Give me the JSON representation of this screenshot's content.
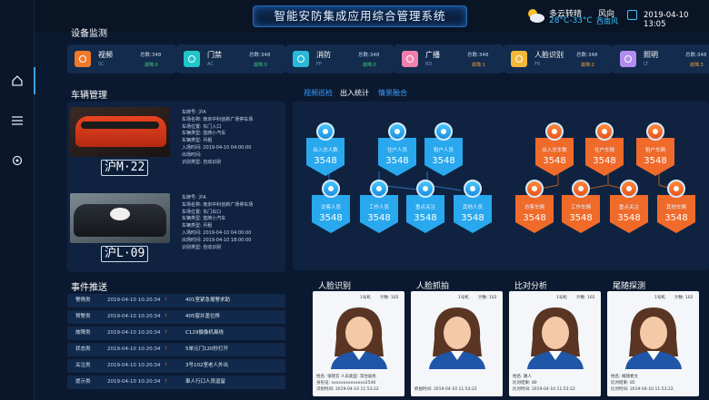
{
  "header": {
    "title": "智能安防集成应用综合管理系统",
    "weather": {
      "desc": "多云转晴",
      "temp": "28°C-33°C"
    },
    "wind": {
      "label": "风向",
      "value": "西南风"
    },
    "date": "2019-04-10 13:05"
  },
  "sections": {
    "device": "设备监测",
    "vehicle": "车辆管理",
    "events": "事件推送"
  },
  "devices": [
    {
      "name": "视频",
      "abbr": "SC",
      "total": "总数:348",
      "fault": "故障:0",
      "icon": "eye-icon",
      "color": "#f07a2b"
    },
    {
      "name": "门禁",
      "abbr": "AC",
      "total": "总数:348",
      "fault": "故障:0",
      "icon": "door-icon",
      "color": "#1fc7c9"
    },
    {
      "name": "消防",
      "abbr": "FP",
      "total": "总数:348",
      "fault": "故障:0",
      "icon": "fire-icon",
      "color": "#2bb7d9"
    },
    {
      "name": "广播",
      "abbr": "BD",
      "total": "总数:348",
      "fault": "故障:1",
      "icon": "speaker-icon",
      "color": "#f07fae"
    },
    {
      "name": "人脸识别",
      "abbr": "FR",
      "total": "总数:348",
      "fault": "故障:2",
      "icon": "face-icon",
      "color": "#f3b83a"
    },
    {
      "name": "照明",
      "abbr": "LT",
      "total": "总数:348",
      "fault": "故障:3",
      "icon": "bulb-icon",
      "color": "#b38cf0"
    }
  ],
  "vehicles": [
    {
      "plate": "沪M·22",
      "lines": [
        "车牌号: 沪A",
        "车场名称: 南京中科创新广场停车场",
        "车场位置: 东门入口",
        "车辆类型: 蓝牌小汽车",
        "车辆类型: 月租",
        "入场时间: 2019-04-10 04:00:00",
        "出场时间:",
        "识别类型: 自动识别"
      ]
    },
    {
      "plate": "沪L·09",
      "lines": [
        "车牌号: 沪A",
        "车场名称: 南京中科创新广场停车场",
        "车场位置: 东门出口",
        "车辆类型: 蓝牌小汽车",
        "车辆类型: 月租",
        "入场时间: 2019-04-10 04:00:00",
        "出场时间: 2019-04-10 18:00:00",
        "识别类型: 自动识别"
      ]
    }
  ],
  "tabs": [
    "视频巡检",
    "出入统计",
    "情景融合"
  ],
  "stats_blue_top": [
    {
      "label": "出入总人数",
      "value": "3548"
    },
    {
      "label": "住户人员",
      "value": "3548"
    },
    {
      "label": "租户人员",
      "value": "3548"
    }
  ],
  "stats_blue_bottom": [
    {
      "label": "访客人员",
      "value": "3548"
    },
    {
      "label": "工作人员",
      "value": "3548"
    },
    {
      "label": "重点关注",
      "value": "3548"
    },
    {
      "label": "其他人员",
      "value": "3548"
    }
  ],
  "stats_orange_top": [
    {
      "label": "出入总车数",
      "value": "3548"
    },
    {
      "label": "住户车辆",
      "value": "3548"
    },
    {
      "label": "租户车辆",
      "value": "3548"
    }
  ],
  "stats_orange_bottom": [
    {
      "label": "访客车辆",
      "value": "3548"
    },
    {
      "label": "工作车辆",
      "value": "3548"
    },
    {
      "label": "重点关注",
      "value": "3548"
    },
    {
      "label": "其他车辆",
      "value": "3548"
    }
  ],
  "events": [
    {
      "tag": "警情类",
      "time": "2019-04-10 10:20:34",
      "desc": "401室紧急报警求助"
    },
    {
      "tag": "预警类",
      "time": "2019-04-10 10:20:34",
      "desc": "405窗并盖位移"
    },
    {
      "tag": "故障类",
      "time": "2019-04-10 10:20:34",
      "desc": "C129摄像机离线"
    },
    {
      "tag": "状态类",
      "time": "2019-04-10 10:20:34",
      "desc": "5单元门120秒打开"
    },
    {
      "tag": "关注类",
      "time": "2019-04-10 10:20:34",
      "desc": "3号102室老人外出"
    },
    {
      "tag": "提示类",
      "time": "2019-04-10 10:20:34",
      "desc": "車人行口人员逗留"
    }
  ],
  "faces": [
    {
      "title": "人脸识别",
      "cam": "1号机",
      "count": "计数: 102",
      "lines": [
        "姓名: 张晓云   人员类型: 常住居民",
        "身份证: xxxxxxxxxxxxxx2546",
        "识别时间: 2019-04-10 11:53:22"
      ]
    },
    {
      "title": "人脸抓拍",
      "cam": "1号机",
      "count": "计数: 102",
      "lines": [
        "",
        "",
        "抓拍时间: 2019-04-10 11:53:22"
      ]
    },
    {
      "title": "比对分析",
      "cam": "1号机",
      "count": "计数: 102",
      "lines": [
        "姓名: 路人",
        "比对结果: 80",
        "比对时间: 2019-04-10 11:53:22"
      ]
    },
    {
      "title": "尾随探测",
      "cam": "1号机",
      "count": "计数: 102",
      "lines": [
        "姓名: 尾随者文",
        "比对结果: 85",
        "比对时间: 2019-04-10 11:53:22"
      ]
    }
  ]
}
